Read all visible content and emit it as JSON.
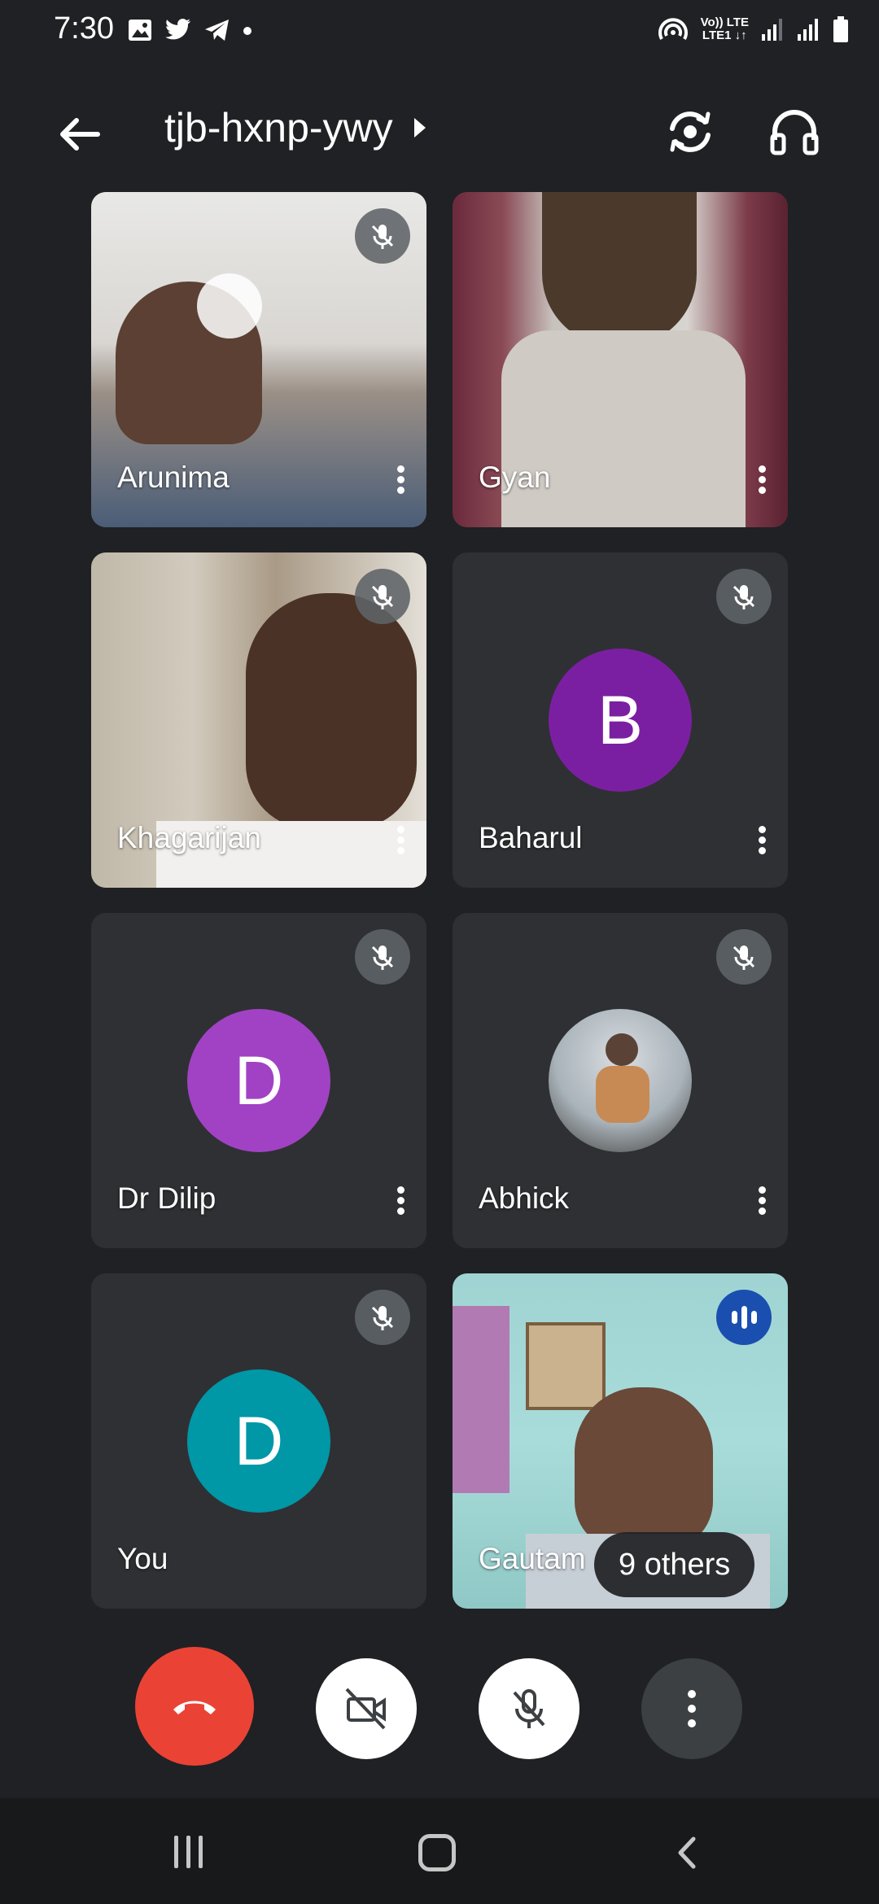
{
  "status_bar": {
    "time": "7:30",
    "lte_line1": "Vo)) LTE",
    "lte_line2": "LTE1 ↓↑",
    "icons": [
      "gallery-icon",
      "twitter-icon",
      "telegram-icon",
      "dot-icon",
      "hotspot-icon",
      "signal-icon",
      "signal-icon",
      "battery-icon"
    ]
  },
  "header": {
    "meeting_code": "tjb-hxnp-ywy",
    "icons": [
      "back-arrow-icon",
      "caret-right-icon",
      "switch-camera-icon",
      "headphones-icon"
    ]
  },
  "participants": [
    {
      "name": "Arunima",
      "type": "video",
      "muted": true
    },
    {
      "name": "Gyan",
      "type": "video",
      "muted": false
    },
    {
      "name": "Khagarijan",
      "type": "video",
      "muted": true
    },
    {
      "name": "Baharul",
      "type": "avatar",
      "initial": "B",
      "avatar_color": "#7b1fa2",
      "muted": true
    },
    {
      "name": "Dr Dilip",
      "type": "avatar",
      "initial": "D",
      "avatar_color": "#a142c4",
      "muted": true
    },
    {
      "name": "Abhick",
      "type": "photo",
      "muted": true
    },
    {
      "name": "You",
      "type": "avatar",
      "initial": "D",
      "avatar_color": "#0097a7",
      "muted": true
    },
    {
      "name": "Gautam",
      "type": "video",
      "speaking": true
    }
  ],
  "others_chip": "9 others",
  "controls": {
    "icons": [
      "end-call-icon",
      "camera-off-icon",
      "mic-off-icon",
      "more-vert-icon"
    ],
    "end_call_color": "#ea4335"
  },
  "nav_bar": {
    "icons": [
      "recents-icon",
      "home-icon",
      "back-icon"
    ]
  }
}
